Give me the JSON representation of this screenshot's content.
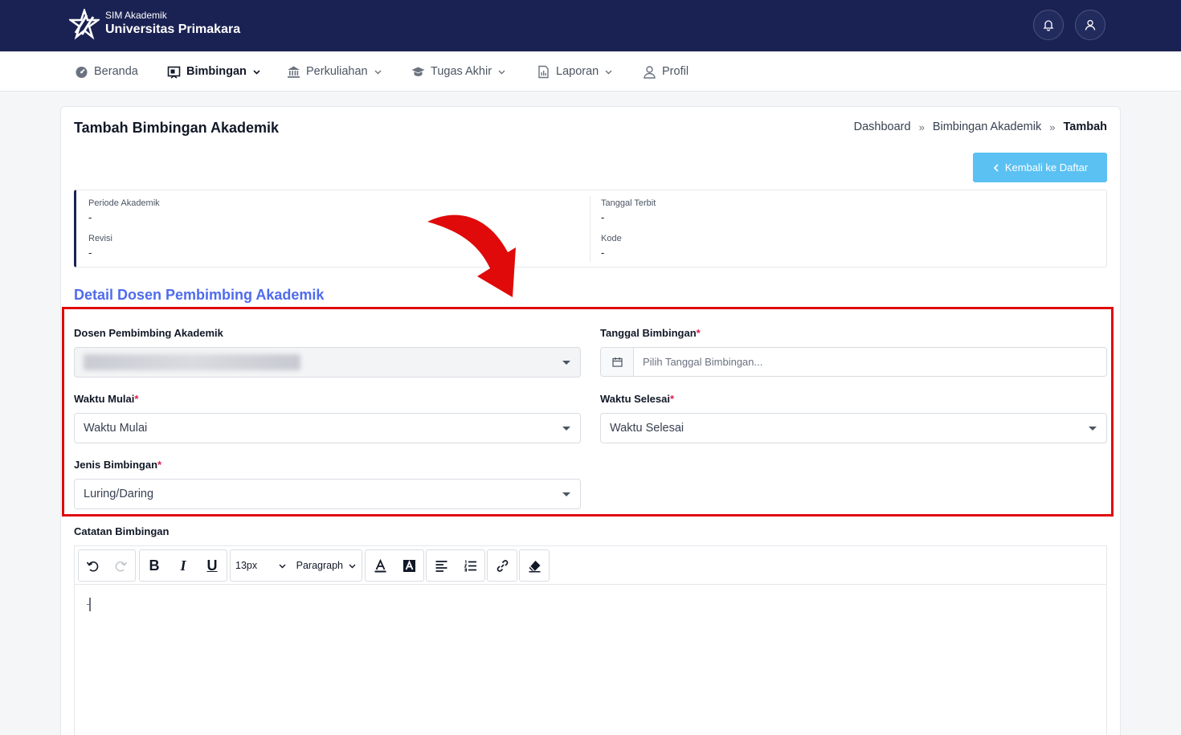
{
  "header": {
    "brand_sub": "SIM Akademik",
    "brand_main": "Universitas Primakara",
    "bg_color": "#1a2253"
  },
  "nav": {
    "items": [
      {
        "label": "Beranda",
        "icon": "dashboard-icon"
      },
      {
        "label": "Bimbingan",
        "icon": "board-icon",
        "active": true,
        "dropdown": true
      },
      {
        "label": "Perkuliahan",
        "icon": "institution-icon",
        "dropdown": true
      },
      {
        "label": "Tugas Akhir",
        "icon": "graduation-cap-icon",
        "dropdown": true
      },
      {
        "label": "Laporan",
        "icon": "report-icon",
        "dropdown": true
      },
      {
        "label": "Profil",
        "icon": "user-icon"
      }
    ]
  },
  "page": {
    "title": "Tambah Bimbingan Akademik",
    "breadcrumb": [
      "Dashboard",
      "Bimbingan Akademik",
      "Tambah"
    ],
    "breadcrumb_sep": "»",
    "back_button": "Kembali ke Daftar",
    "accent_color": "#5bc1f3"
  },
  "info": {
    "periode_label": "Periode Akademik",
    "periode_value": "-",
    "tanggal_terbit_label": "Tanggal Terbit",
    "tanggal_terbit_value": "-",
    "revisi_label": "Revisi",
    "revisi_value": "-",
    "kode_label": "Kode",
    "kode_value": "-"
  },
  "form": {
    "section_title": "Detail Dosen Pembimbing Akademik",
    "dosen_label": "Dosen Pembimbing Akademik",
    "tanggal_label": "Tanggal Bimbingan",
    "tanggal_placeholder": "Pilih Tanggal Bimbingan...",
    "waktu_mulai_label": "Waktu Mulai",
    "waktu_mulai_value": "Waktu Mulai",
    "waktu_selesai_label": "Waktu Selesai",
    "waktu_selesai_value": "Waktu Selesai",
    "jenis_label": "Jenis Bimbingan",
    "jenis_value": "Luring/Daring",
    "required_mark": "*",
    "catatan_label": "Catatan Bimbingan"
  },
  "editor": {
    "font_size": "13px",
    "block_format": "Paragraph",
    "bold": "B",
    "italic": "I",
    "underline": "U"
  },
  "annotation": {
    "highlight_color": "#e00a0a"
  }
}
